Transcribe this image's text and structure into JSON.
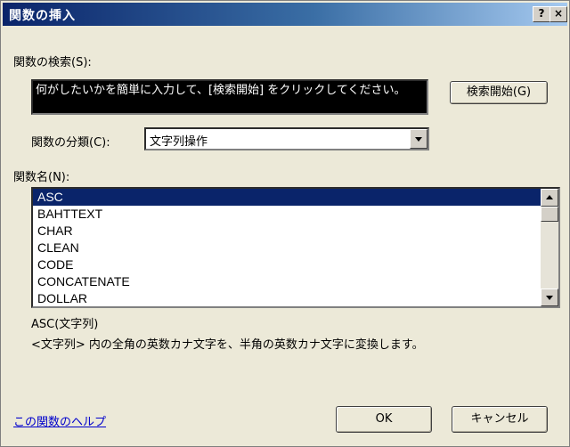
{
  "dialog": {
    "title": "関数の挿入",
    "help_button": "?",
    "close_button": "×"
  },
  "search": {
    "label": "関数の検索(S):",
    "value": "何がしたいかを簡単に入力して、[検索開始] をクリックしてください。",
    "start_button": "検索開始(G)"
  },
  "category": {
    "label": "関数の分類(C):",
    "selected": "文字列操作"
  },
  "functions": {
    "label": "関数名(N):",
    "items": [
      "ASC",
      "BAHTTEXT",
      "CHAR",
      "CLEAN",
      "CODE",
      "CONCATENATE",
      "DOLLAR"
    ],
    "selected_index": 0
  },
  "details": {
    "signature": "ASC(文字列)",
    "description": "<文字列> 内の全角の英数カナ文字を、半角の英数カナ文字に変換します。"
  },
  "footer": {
    "help_link": "この関数のヘルプ",
    "ok_button": "OK",
    "cancel_button": "キャンセル"
  },
  "colors": {
    "title_bar": "#0a246a",
    "selection": "#0a246a",
    "link": "#0000cc",
    "dialog_bg": "#ece9d8"
  }
}
